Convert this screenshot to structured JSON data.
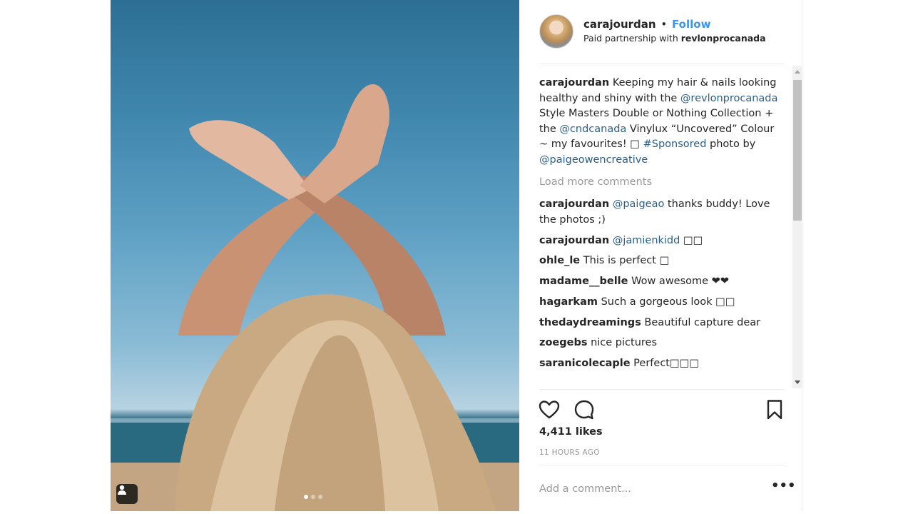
{
  "post": {
    "username": "carajourdan",
    "separator": "•",
    "follow_label": "Follow",
    "partnership_prefix": "Paid partnership with ",
    "partner": "revlonprocanada",
    "image_indicator": {
      "total": 3,
      "current": 1
    }
  },
  "caption": {
    "user": "carajourdan",
    "t1": " Keeping my hair & nails looking healthy and shiny with the ",
    "m1": "@revlonprocanada",
    "t2": " Style Masters Double or Nothing Collection + the ",
    "m2": "@cndcanada",
    "t3": " Vinylux “Uncovered” Colour ~ my favourites! □ ",
    "m3": "#Sponsored",
    "t4": " photo by ",
    "m4": "@paigeowencreative"
  },
  "load_more": "Load more comments",
  "comments": {
    "c1": {
      "user": "carajourdan",
      "mention": "@paigeao",
      "text": " thanks buddy! Love the photos ;)"
    },
    "c2": {
      "user": "carajourdan",
      "mention": "@jamienkidd",
      "text": " □□"
    },
    "c3": {
      "user": "ohle_le",
      "text": " This is perfect □"
    },
    "c4": {
      "user": "madame__belle",
      "text": " Wow awesome ❤❤"
    },
    "c5": {
      "user": "hagarkam",
      "text": " Such a gorgeous look □□"
    },
    "c6": {
      "user": "thedaydreamings",
      "text": " Beautiful capture dear"
    },
    "c7": {
      "user": "zoegebs",
      "text": " nice pictures"
    },
    "c8": {
      "user": "saranicolecaple",
      "text": " Perfect□□□"
    }
  },
  "stats": {
    "likes": "4,411 likes",
    "time": "11 HOURS AGO"
  },
  "add_comment": {
    "placeholder": "Add a comment...",
    "more_label": "•••"
  },
  "icons": {
    "like": "heart-icon",
    "comment": "comment-bubble-icon",
    "save": "bookmark-icon",
    "tag": "user-tag-icon",
    "more": "more-options-icon"
  },
  "colors": {
    "link": "#3897f0",
    "mention": "#2b5f86",
    "muted": "#999999",
    "text": "#262626"
  }
}
